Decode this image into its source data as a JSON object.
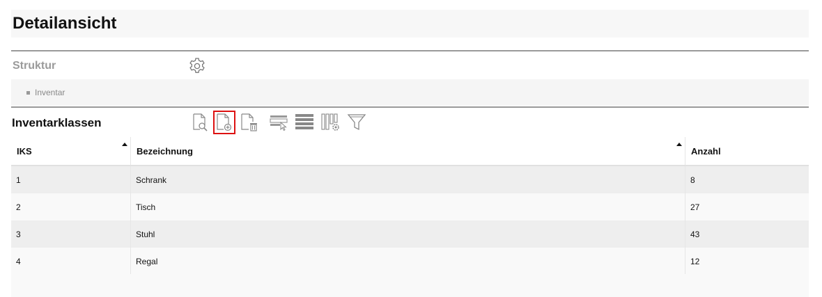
{
  "page": {
    "title": "Detailansicht"
  },
  "struktur": {
    "label": "Struktur",
    "settings_icon": "gear-icon"
  },
  "tree": {
    "items": [
      {
        "label": "Inventar"
      }
    ]
  },
  "inventarklassen": {
    "label": "Inventarklassen",
    "toolbar": [
      {
        "icon": "document-search-icon",
        "active": false
      },
      {
        "icon": "document-add-icon",
        "active": true
      },
      {
        "icon": "document-delete-icon",
        "active": false
      },
      {
        "icon": "row-select-icon",
        "active": false
      },
      {
        "icon": "rows-list-icon",
        "active": false
      },
      {
        "icon": "columns-settings-icon",
        "active": false
      },
      {
        "icon": "filter-icon",
        "active": false
      }
    ],
    "active_border_color": "#dd1111"
  },
  "table": {
    "columns": [
      "IKS",
      "Bezeichnung",
      "Anzahl"
    ],
    "rows": [
      [
        "1",
        "Schrank",
        "8"
      ],
      [
        "2",
        "Tisch",
        "27"
      ],
      [
        "3",
        "Stuhl",
        "43"
      ],
      [
        "4",
        "Regal",
        "12"
      ]
    ]
  }
}
